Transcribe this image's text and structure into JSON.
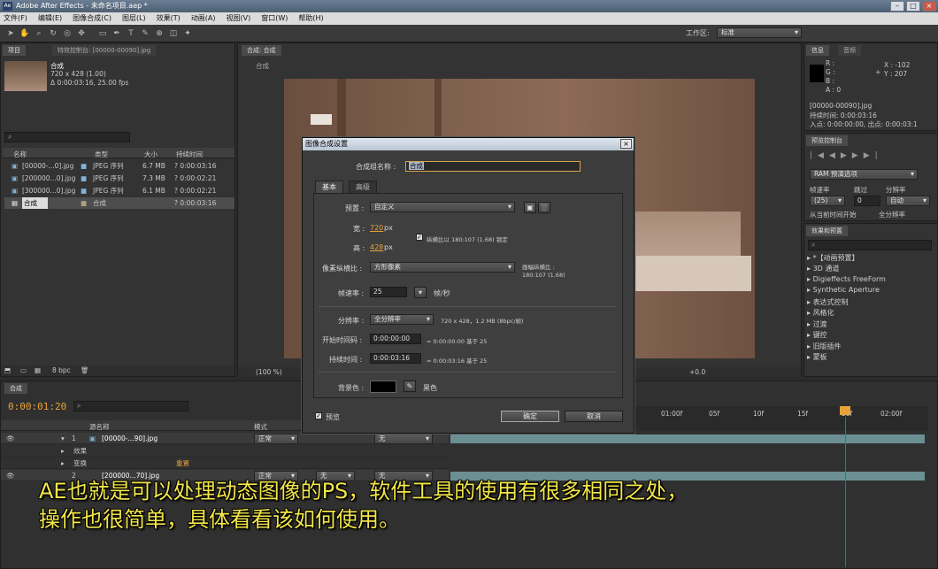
{
  "window": {
    "title": "Adobe After Effects - 未命名项目.aep *",
    "logo_text": "Ae"
  },
  "menu": [
    "文件(F)",
    "编辑(E)",
    "图像合成(C)",
    "图层(L)",
    "效果(T)",
    "动画(A)",
    "视图(V)",
    "窗口(W)",
    "帮助(H)"
  ],
  "toolbar": {
    "workspace_label": "工作区:",
    "workspace_value": "标准"
  },
  "project": {
    "tab": "项目",
    "tab2": "特效控制台: [00000-00090].jpg",
    "preview_name": "合成",
    "preview_size": "720 x 428 (1.00)",
    "preview_duration": "Δ 0:00:03:16, 25.00 fps",
    "columns": [
      "名称",
      "类型",
      "大小",
      "持续时间"
    ],
    "items": [
      {
        "name": "[00000-...0].jpg",
        "type": "JPEG 序列",
        "size": "6.7 MB",
        "duration": "? 0:00:03:16"
      },
      {
        "name": "[200000...0].jpg",
        "type": "JPEG 序列",
        "size": "7.3 MB",
        "duration": "? 0:00:02:21"
      },
      {
        "name": "[300000...0].jpg",
        "type": "JPEG 序列",
        "size": "6.1 MB",
        "duration": "? 0:00:02:21"
      },
      {
        "name": "合成",
        "type": "合成",
        "size": "",
        "duration": "? 0:00:03:16"
      }
    ],
    "bpc": "8 bpc"
  },
  "comp_viewer": {
    "tab": "合成: 合成",
    "label": "合成",
    "zoom": "(100 %)",
    "offset": "+0.0"
  },
  "info_panel": {
    "tab1": "信息",
    "tab2": "音频",
    "r": "R :",
    "g": "G :",
    "b": "B :",
    "a": "A : 0",
    "x": "X : -102",
    "y": "Y : 207",
    "file": "[00000-00090].jpg",
    "duration": "持续时间: 0:00:03:16",
    "inout": "入点: 0:00:00:00, 出点: 0:00:03:1"
  },
  "preview_panel": {
    "tab": "预览控制台",
    "ram": "RAM 预演选项",
    "frame_rate": "帧速率",
    "skip": "跳过",
    "resolution": "分辨率",
    "frame_rate_val": "(25)",
    "skip_val": "0",
    "resolution_val": "自动",
    "from_current": "从当前时间开始",
    "full_screen": "全分辨率"
  },
  "effects_panel": {
    "tab": "效果和预置",
    "items": [
      "*【动画预置】",
      "3D 通道",
      "Digieffects FreeForm",
      "Synthetic Aperture",
      "表达式控制",
      "风格化",
      "过渡",
      "键控",
      "旧版插件",
      "蒙板"
    ]
  },
  "timeline": {
    "tab": "合成",
    "time": "0:00:01:20",
    "columns": {
      "source": "源名称",
      "mode": "模式",
      "parent": "父级"
    },
    "layers": [
      {
        "num": "1",
        "name": "[00000-...90].jpg",
        "mode": "正常",
        "parent": "无"
      },
      {
        "num": "2",
        "name": "[200000...70].jpg",
        "mode": "正常",
        "trk": "无",
        "parent": "无"
      }
    ],
    "sub_effects": "效果",
    "sub_transform": "变换",
    "reset": "重置",
    "ruler": [
      "01:00f",
      "05f",
      "10f",
      "15f",
      "20f",
      "02:00f"
    ]
  },
  "dialog": {
    "title": "图像合成设置",
    "name_label": "合成组名称 :",
    "name_value": "合成",
    "tab_basic": "基本",
    "tab_advanced": "高级",
    "preset_label": "预置 :",
    "preset_value": "自定义",
    "width_label": "宽 :",
    "width_value": "720",
    "height_label": "高 :",
    "height_value": "428",
    "px": "px",
    "lock_aspect": "纵横比以 180:107 (1.68) 锁定",
    "pixel_aspect_label": "像素纵横比 :",
    "pixel_aspect_value": "方形像素",
    "frame_aspect_label": "画幅纵横比 :",
    "frame_aspect_value": "180:107 (1.68)",
    "fps_label": "帧速率 :",
    "fps_value": "25",
    "fps_unit": "帧/秒",
    "res_label": "分辨率 :",
    "res_value": "全分辨率",
    "res_info": "720 x 428，1.2 MB (8bpc/帧)",
    "start_label": "开始时间码 :",
    "start_value": "0:00:00:00",
    "start_info": "= 0:00:00:00  基于 25",
    "dur_label": "持续时间 :",
    "dur_value": "0:00:03:16",
    "dur_info": "= 0:00:03:16  基于 25",
    "bg_label": "背景色 :",
    "bg_color_name": "黑色",
    "preview_label": "预览",
    "ok": "确定",
    "cancel": "取消"
  },
  "subtitles": {
    "line1": "AE也就是可以处理动态图像的PS，软件工具的使用有很多相同之处，",
    "line2": "操作也很简单，具体看看该如何使用。"
  },
  "colors": {
    "accent_orange": "#e8a23a",
    "subtitle_yellow": "#f2e64a",
    "panel_bg": "#333333"
  }
}
